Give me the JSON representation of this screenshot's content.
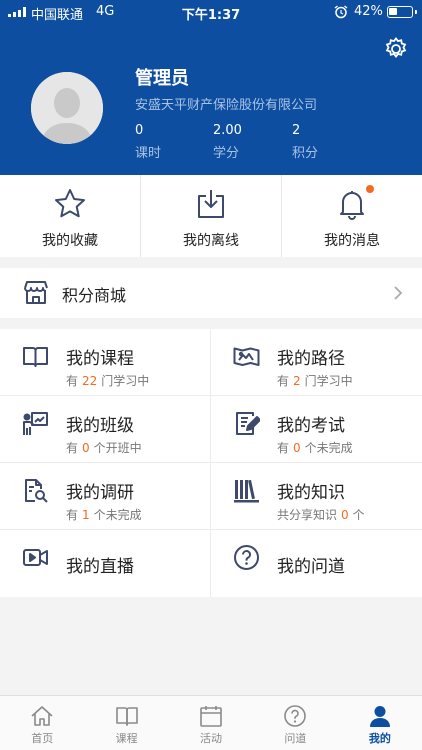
{
  "status_bar": {
    "carrier": "中国联通",
    "network": "4G",
    "time": "下午1:37",
    "battery_percent": "42%",
    "battery_level": 0.42
  },
  "profile": {
    "name": "管理员",
    "company": "安盛天平财产保险股份有限公司",
    "stats": [
      {
        "value": "0",
        "label": "课时"
      },
      {
        "value": "2.00",
        "label": "学分"
      },
      {
        "value": "2",
        "label": "积分"
      }
    ]
  },
  "quick_actions": [
    {
      "label": "我的收藏",
      "icon": "star-icon"
    },
    {
      "label": "我的离线",
      "icon": "download-icon"
    },
    {
      "label": "我的消息",
      "icon": "bell-icon"
    }
  ],
  "mall": {
    "label": "积分商城",
    "icon": "store-icon"
  },
  "grid": [
    {
      "title": "我的课程",
      "icon": "book-icon",
      "pre": "有",
      "count": "22",
      "post": "门学习中"
    },
    {
      "title": "我的路径",
      "icon": "map-icon",
      "pre": "有",
      "count": "2",
      "post": "门学习中"
    },
    {
      "title": "我的班级",
      "icon": "teacher-icon",
      "pre": "有",
      "count": "0",
      "post": "个开班中"
    },
    {
      "title": "我的考试",
      "icon": "exam-icon",
      "pre": "有",
      "count": "0",
      "post": "个未完成"
    },
    {
      "title": "我的调研",
      "icon": "survey-icon",
      "pre": "有",
      "count": "1",
      "post": "个未完成"
    },
    {
      "title": "我的知识",
      "icon": "library-icon",
      "pre": "共分享知识",
      "count": "0",
      "post": "个"
    },
    {
      "title": "我的直播",
      "icon": "video-icon"
    },
    {
      "title": "我的问道",
      "icon": "question-icon"
    }
  ],
  "tabs": [
    {
      "label": "首页",
      "icon": "home-icon",
      "active": false
    },
    {
      "label": "课程",
      "icon": "book-icon",
      "active": false
    },
    {
      "label": "活动",
      "icon": "calendar-icon",
      "active": false
    },
    {
      "label": "问道",
      "icon": "question-icon",
      "active": false
    },
    {
      "label": "我的",
      "icon": "user-icon",
      "active": true
    }
  ],
  "colors": {
    "brand": "#0d4ea0",
    "accent": "#f26b21",
    "icon": "#3d4a6b"
  }
}
